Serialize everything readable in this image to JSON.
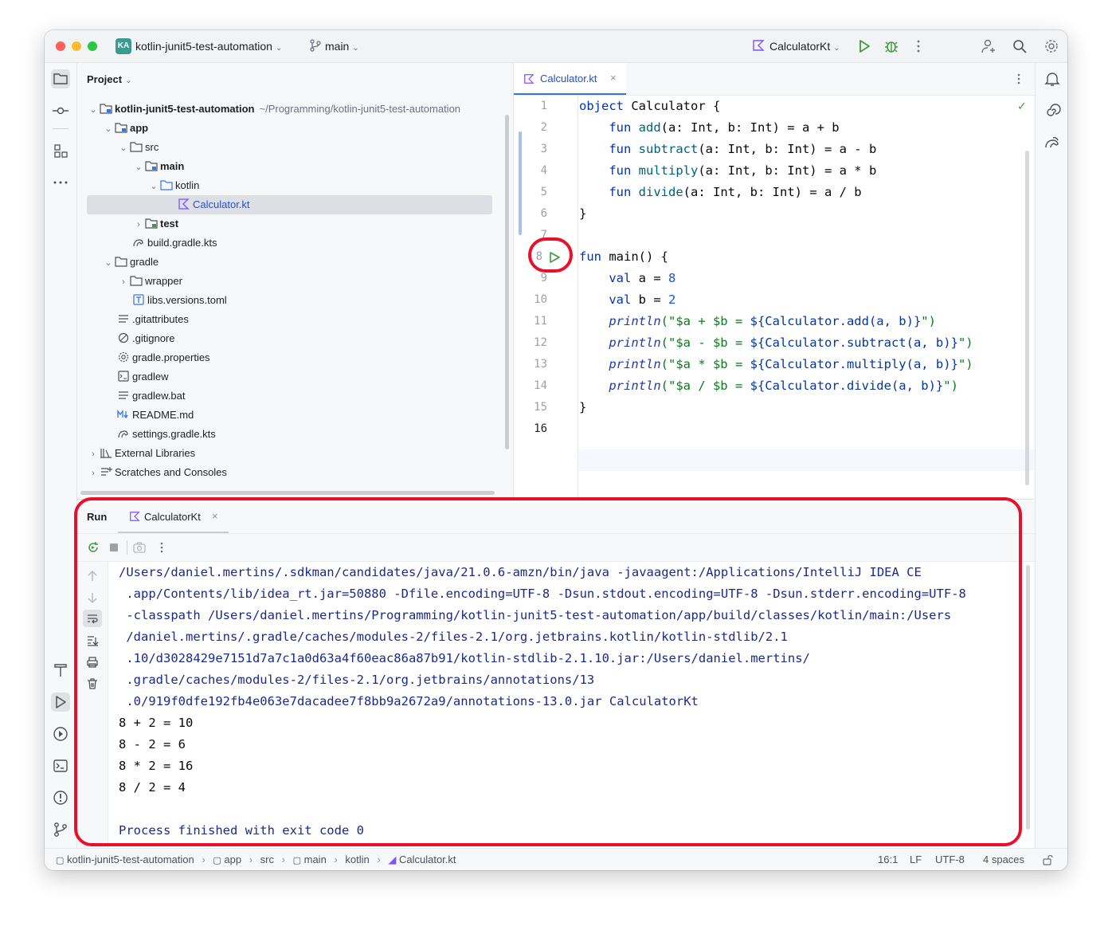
{
  "titlebar": {
    "project_badge": "KA",
    "project_name": "kotlin-junit5-test-automation",
    "branch": "main",
    "run_config": "CalculatorKt"
  },
  "project_panel": {
    "title": "Project",
    "items": [
      {
        "label": "kotlin-junit5-test-automation",
        "path": "~/Programming/kotlin-junit5-test-automation"
      },
      {
        "label": "app"
      },
      {
        "label": "src"
      },
      {
        "label": "main"
      },
      {
        "label": "kotlin"
      },
      {
        "label": "Calculator.kt"
      },
      {
        "label": "test"
      },
      {
        "label": "build.gradle.kts"
      },
      {
        "label": "gradle"
      },
      {
        "label": "wrapper"
      },
      {
        "label": "libs.versions.toml"
      },
      {
        "label": ".gitattributes"
      },
      {
        "label": ".gitignore"
      },
      {
        "label": "gradle.properties"
      },
      {
        "label": "gradlew"
      },
      {
        "label": "gradlew.bat"
      },
      {
        "label": "README.md"
      },
      {
        "label": "settings.gradle.kts"
      },
      {
        "label": "External Libraries"
      },
      {
        "label": "Scratches and Consoles"
      }
    ]
  },
  "editor": {
    "tab_label": "Calculator.kt",
    "line_numbers": [
      "1",
      "2",
      "3",
      "4",
      "5",
      "6",
      "7",
      "8",
      "9",
      "10",
      "11",
      "12",
      "13",
      "14",
      "15",
      "16"
    ],
    "code": {
      "l1a": "object",
      "l1b": " Calculator {",
      "fun": "fun",
      "l2f": "add",
      "l2r": "(a: Int, b: Int) = a + b",
      "l3f": "subtract",
      "l3r": "(a: Int, b: Int) = a - b",
      "l4f": "multiply",
      "l4r": "(a: Int, b: Int) = a * b",
      "l5f": "divide",
      "l5r": "(a: Int, b: Int) = a / b",
      "close": "}",
      "l8": " main() {",
      "val": "val",
      "l9a": " a = ",
      "l9n": "8",
      "l10a": " b = ",
      "l10n": "2",
      "println": "println",
      "l11s1": "(\"$a + $b = ",
      "l11t": "${Calculator.add(a, b)}",
      "l11s2": "\")",
      "l12s1": "(\"$a - $b = ",
      "l12t": "${Calculator.subtract(a, b)}",
      "l12s2": "\")",
      "l13s1": "(\"$a * $b = ",
      "l13t": "${Calculator.multiply(a, b)}",
      "l13s2": "\")",
      "l14s1": "(\"$a / $b = ",
      "l14t": "${Calculator.divide(a, b)}",
      "l14s2": "\")"
    }
  },
  "run_panel": {
    "label": "Run",
    "tab_label": "CalculatorKt",
    "command_lines": [
      "/Users/daniel.mertins/.sdkman/candidates/java/21.0.6-amzn/bin/java -javaagent:/Applications/IntelliJ IDEA CE",
      " .app/Contents/lib/idea_rt.jar=50880 -Dfile.encoding=UTF-8 -Dsun.stdout.encoding=UTF-8 -Dsun.stderr.encoding=UTF-8",
      " -classpath /Users/daniel.mertins/Programming/kotlin-junit5-test-automation/app/build/classes/kotlin/main:/Users",
      " /daniel.mertins/.gradle/caches/modules-2/files-2.1/org.jetbrains.kotlin/kotlin-stdlib/2.1",
      " .10/d3028429e7151d7a7c1a0d63a4f60eac86a87b91/kotlin-stdlib-2.1.10.jar:/Users/daniel.mertins/",
      " .gradle/caches/modules-2/files-2.1/org.jetbrains/annotations/13",
      " .0/919f0dfe192fb4e063e7dacadee7f8bb9a2672a9/annotations-13.0.jar CalculatorKt"
    ],
    "output_lines": [
      "8 + 2 = 10",
      "8 - 2 = 6",
      "8 * 2 = 16",
      "8 / 2 = 4"
    ],
    "exit_message": "Process finished with exit code 0"
  },
  "status_bar": {
    "breadcrumbs": [
      "kotlin-junit5-test-automation",
      "app",
      "src",
      "main",
      "kotlin",
      "Calculator.kt"
    ],
    "position": "16:1",
    "line_ending": "LF",
    "encoding": "UTF-8",
    "indent": "4 spaces"
  },
  "colors": {
    "accent": "#3574f0",
    "highlight": "#e8102a",
    "run_green": "#3e9b3e"
  }
}
